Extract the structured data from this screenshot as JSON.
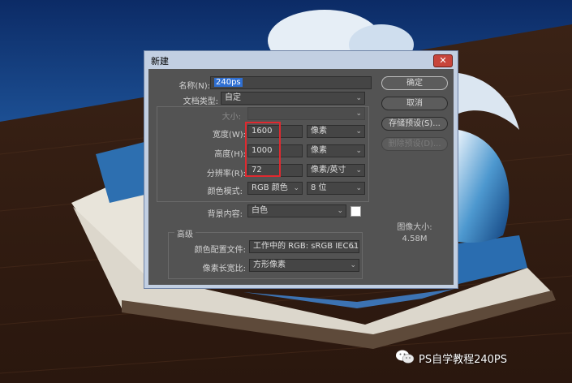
{
  "dialog": {
    "title": "新建",
    "close_glyph": "✕",
    "name_label": "名称(N):",
    "name_value": "240ps",
    "doc_type_label": "文档类型:",
    "doc_type_value": "自定",
    "size_label": "大小:",
    "width_label": "宽度(W):",
    "width_value": "1600",
    "width_unit": "像素",
    "height_label": "高度(H):",
    "height_value": "1000",
    "height_unit": "像素",
    "resolution_label": "分辨率(R):",
    "resolution_value": "72",
    "resolution_unit": "像素/英寸",
    "color_mode_label": "颜色模式:",
    "color_mode_value": "RGB 颜色",
    "bit_depth_value": "8 位",
    "background_label": "背景内容:",
    "background_value": "白色",
    "advanced_title": "高级",
    "color_profile_label": "颜色配置文件:",
    "color_profile_value": "工作中的 RGB: sRGB IEC61...",
    "pixel_aspect_label": "像素长宽比:",
    "pixel_aspect_value": "方形像素",
    "ok_label": "确定",
    "cancel_label": "取消",
    "save_preset_label": "存储预设(S)...",
    "delete_preset_label": "删除预设(D)...",
    "image_size_label": "图像大小:",
    "image_size_value": "4.58M",
    "dropdown_arrow": "⌄"
  },
  "watermark": {
    "text": "PS自学教程240PS"
  },
  "colors": {
    "dialog_frame": "#c2cfe2",
    "panel": "#535353",
    "highlight": "#e0292f",
    "selection": "#2f6fd2"
  }
}
